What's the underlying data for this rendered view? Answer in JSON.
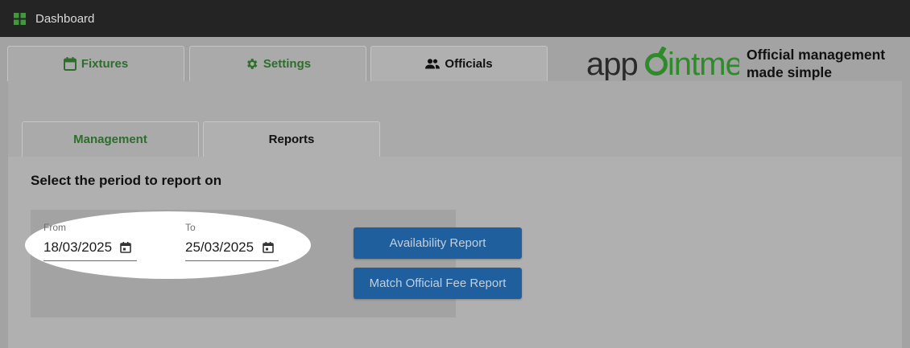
{
  "topbar": {
    "title": "Dashboard",
    "icon": "grid-icon"
  },
  "tabs": [
    {
      "label": "Fixtures",
      "icon": "calendar-icon",
      "active": false
    },
    {
      "label": "Settings",
      "icon": "gear-icon",
      "active": false
    },
    {
      "label": "Officials",
      "icon": "people-icon",
      "active": true
    }
  ],
  "brand": {
    "logo_text": "appointme",
    "tagline_line1": "Official management",
    "tagline_line2": "made simple"
  },
  "subtabs": [
    {
      "label": "Management",
      "active": false
    },
    {
      "label": "Reports",
      "active": true
    }
  ],
  "report": {
    "heading": "Select the period to report on",
    "from": {
      "label": "From",
      "value": "18/03/2025"
    },
    "to": {
      "label": "To",
      "value": "25/03/2025"
    }
  },
  "buttons": {
    "availability": "Availability Report",
    "fee": "Match Official Fee Report"
  },
  "colors": {
    "green": "#2d6e2a",
    "button_blue": "#1f5f9e",
    "topbar": "#242424"
  }
}
